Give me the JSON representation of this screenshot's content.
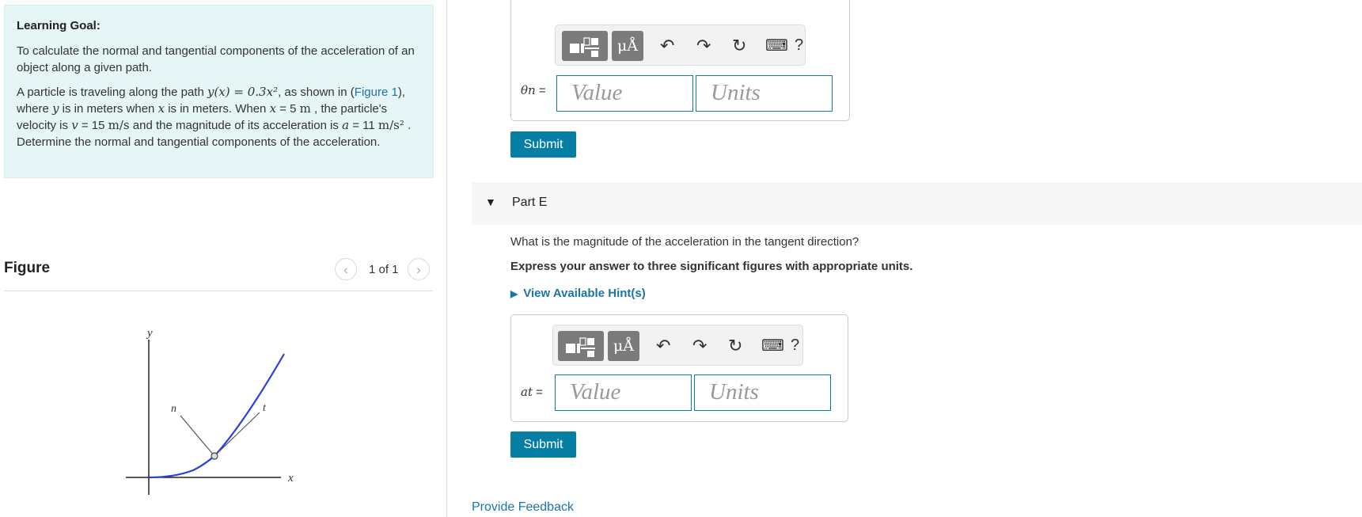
{
  "learning_goal": {
    "heading": "Learning Goal:",
    "text": "To calculate the normal and tangential components of the acceleration of an object along a given path.",
    "problem": {
      "p1": "A particle is traveling along the path ",
      "path_expr": "y(x) = 0.3x²",
      "p2": ", as shown in (",
      "figure_link": "Figure 1",
      "p3": "), where ",
      "y_var": "y",
      "p4": " is in meters when ",
      "x_var": "x",
      "p5": " is in meters. When ",
      "x_var2": "x",
      "p6": " = 5 ",
      "unit_m": "m",
      "p7": " , the particle's velocity is ",
      "v_var": "v",
      "p8": " = 15 ",
      "v_unit": "m/s",
      "p9": " and the magnitude of its acceleration is ",
      "a_var": "a",
      "p10": " = 11 ",
      "a_unit": "m/s²",
      "p11": " . Determine the normal and tangential components of the acceleration."
    }
  },
  "figure": {
    "title": "Figure",
    "prev_icon": "‹",
    "next_icon": "›",
    "counter": "1 of 1",
    "labels": {
      "y_axis": "y",
      "x_axis": "x",
      "normal": "n",
      "tangent": "t"
    },
    "colors": {
      "curve": "#2a3fe0",
      "axes": "#222",
      "vectors": "#555"
    }
  },
  "part_d": {
    "field_label_var": "θn",
    "field_label_eq": " =",
    "value_placeholder": "Value",
    "units_placeholder": "Units",
    "submit": "Submit"
  },
  "toolbar": {
    "template_icon": "template-icon",
    "units_symbol": "μÅ",
    "undo": "↶",
    "redo": "↷",
    "reset": "↻",
    "keyboard": "⌨",
    "help": "?"
  },
  "part_e": {
    "label": "Part E",
    "question": "What is the magnitude of the acceleration in the tangent direction?",
    "instruction": "Express your answer to three significant figures with appropriate units.",
    "hint": "View Available Hint(s)",
    "field_label_var": "at",
    "field_label_eq": " =",
    "value_placeholder": "Value",
    "units_placeholder": "Units",
    "submit": "Submit"
  },
  "footer": {
    "feedback": "Provide Feedback"
  },
  "colors": {
    "accent": "#077fa5",
    "link": "#1a75a8",
    "goal_bg": "#e6f5f6"
  }
}
